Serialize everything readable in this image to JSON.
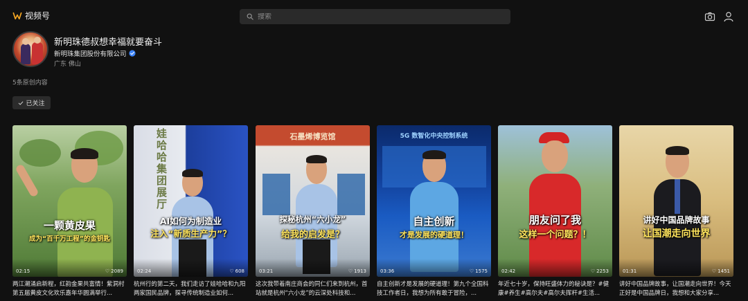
{
  "app": {
    "name": "视频号"
  },
  "search": {
    "placeholder": "搜索"
  },
  "profile": {
    "title": "新明珠德叔想幸福就要奋斗",
    "org": "新明珠集团股份有限公司",
    "location": "广东 佛山",
    "content_count": "5条原创内容",
    "follow_label": "已关注"
  },
  "videos": [
    {
      "line1": "一颗黄皮果",
      "line2": "成为“百千万工程”的金钥匙",
      "duration": "02:15",
      "likes": "2089",
      "caption": "两江潮涌启新程，红韵金果共富情！紫洞村第五届黄皮文化欢乐嘉年华圆满举行..."
    },
    {
      "line1": "AI如何为制造业",
      "line2": "注入“新质生产力”？",
      "extra": "娃哈哈集团展厅",
      "duration": "02:24",
      "likes": "608",
      "caption": "杭州行的第二天，我们走访了娃哈哈和九阳两家国民品牌，探寻传统制造业如何..."
    },
    {
      "line1": "探秘杭州“六小龙”",
      "line2": "给我的启发是？",
      "extra": "石墨烯博览馆",
      "duration": "03:21",
      "likes": "1913",
      "caption": "这次我带着南庄商会的同仁们来到杭州，首站就是杭州“六小龙”的云深处科技和..."
    },
    {
      "line1": "自主创新",
      "line2": "才是发展的硬道理！",
      "extra": "5G 数智化中央控制系统",
      "duration": "03:36",
      "likes": "1575",
      "caption": "自主创新才是发展的硬道理！第九个全国科技工作者日，我想为所有敢于冒险，..."
    },
    {
      "line1": "朋友问了我",
      "line2": "这样一个问题？！",
      "duration": "02:42",
      "likes": "2253",
      "caption": "年近七十岁，保持旺盛体力的秘诀是？#健康#养生#高尔夫#高尔夫挥杆#生活..."
    },
    {
      "line1": "讲好中国品牌故事",
      "line2": "让国潮走向世界",
      "duration": "01:31",
      "likes": "1451",
      "caption": "讲好中国品牌故事，让国潮走向世界！今天正好是中国品牌日，我想和大家分享..."
    }
  ]
}
